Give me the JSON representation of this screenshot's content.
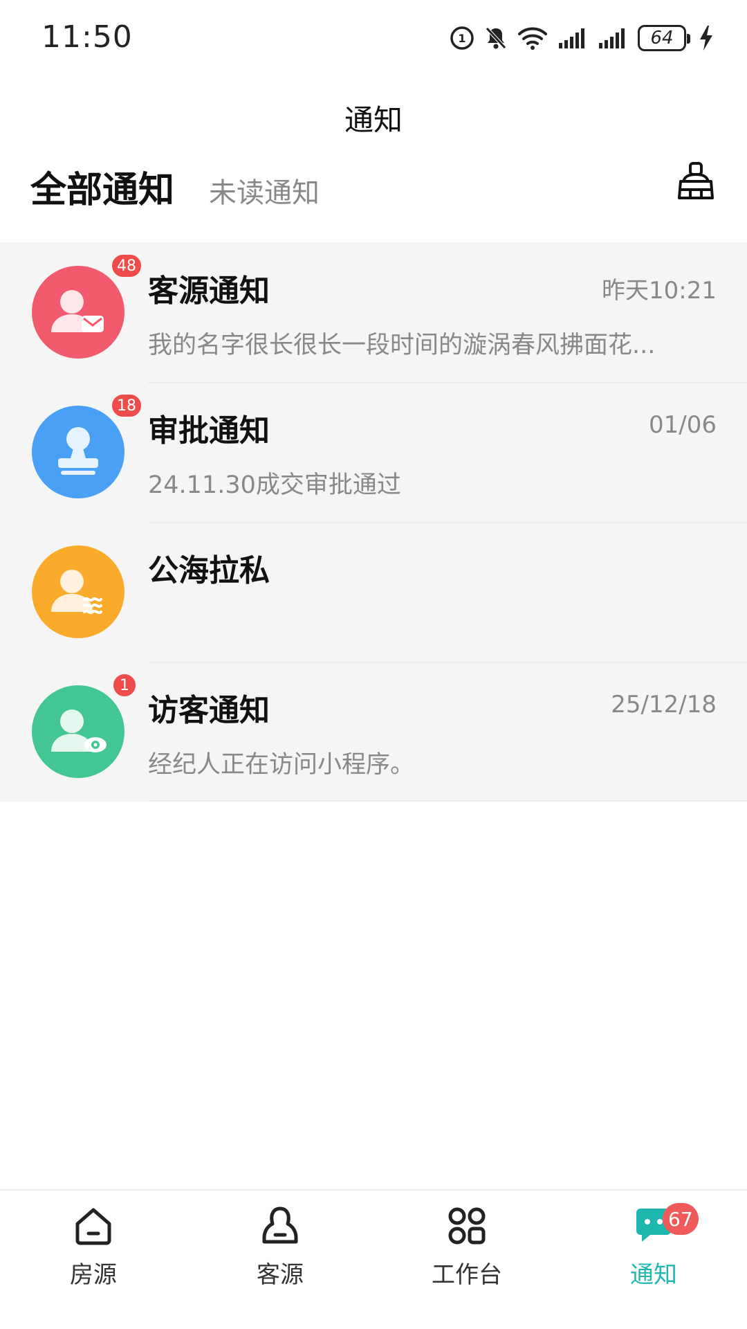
{
  "status_bar": {
    "time": "11:50",
    "battery": "64",
    "icons": [
      "hd-icon",
      "bell-off-icon",
      "wifi-icon",
      "signal-icon",
      "signal-icon",
      "battery-icon",
      "charging-icon"
    ]
  },
  "header": {
    "title": "通知"
  },
  "tabs": [
    {
      "label": "全部通知",
      "active": true
    },
    {
      "label": "未读通知",
      "active": false
    }
  ],
  "toolbar": {
    "clear_icon": "broom-icon"
  },
  "notifications": [
    {
      "title": "客源通知",
      "time": "昨天10:21",
      "preview": "我的名字很长很长一段时间的漩涡春风拂面花...",
      "badge": "48",
      "color": "#f25a6e",
      "icon": "user-mail-icon"
    },
    {
      "title": "审批通知",
      "time": "01/06",
      "preview": "24.11.30成交审批通过",
      "badge": "18",
      "color": "#4aa0f5",
      "icon": "stamp-icon"
    },
    {
      "title": "公海拉私",
      "time": "",
      "preview": "",
      "badge": "",
      "color": "#fbab2c",
      "icon": "user-waves-icon"
    },
    {
      "title": "访客通知",
      "time": "25/12/18",
      "preview": "经纪人正在访问小程序。",
      "badge": "1",
      "color": "#43c694",
      "icon": "user-eye-icon"
    }
  ],
  "bottom_nav": [
    {
      "label": "房源",
      "icon": "house-icon",
      "active": false
    },
    {
      "label": "客源",
      "icon": "person-icon",
      "active": false
    },
    {
      "label": "工作台",
      "icon": "grid-icon",
      "active": false
    },
    {
      "label": "通知",
      "icon": "chat-icon",
      "active": true,
      "badge": "67"
    }
  ],
  "colors": {
    "accent": "#1fb8b1",
    "badge": "#ee4b4b"
  }
}
